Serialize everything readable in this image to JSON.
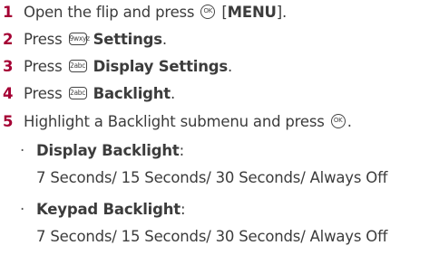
{
  "steps": [
    {
      "num": "1",
      "pre": "Open the flip and press ",
      "key_icon": "ok-key-icon",
      "key_glyph": "OK",
      "post": " [",
      "bold": "MENU",
      "end": "]."
    },
    {
      "num": "2",
      "pre": "Press ",
      "key_icon": "key-9-icon",
      "key_glyph": "9wxyz",
      "bold": "Settings",
      "end": "."
    },
    {
      "num": "3",
      "pre": "Press ",
      "key_icon": "key-2-icon",
      "key_glyph": "2abc",
      "bold": "Display Settings",
      "end": "."
    },
    {
      "num": "4",
      "pre": "Press ",
      "key_icon": "key-2-icon",
      "key_glyph": "2abc",
      "bold": "Backlight",
      "end": "."
    },
    {
      "num": "5",
      "pre": "Highlight a Backlight submenu and press ",
      "key_icon": "ok-key-icon",
      "key_glyph": "OK",
      "end": "."
    }
  ],
  "submenu": [
    {
      "bullet": "·",
      "bold": "Display Backlight",
      "colon": ":",
      "options": "7 Seconds/ 15 Seconds/ 30 Seconds/ Always Off"
    },
    {
      "bullet": "·",
      "bold": "Keypad Backlight",
      "colon": ":",
      "options": "7 Seconds/ 15 Seconds/ 30 Seconds/ Always Off"
    }
  ],
  "colors": {
    "step_number": "#a50034",
    "text": "#3c3c3c"
  }
}
